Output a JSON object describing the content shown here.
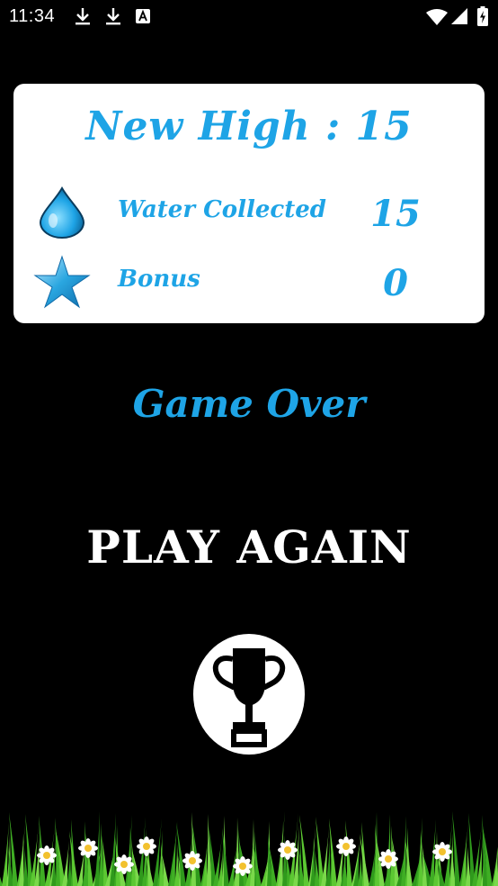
{
  "status_bar": {
    "time": "11:34",
    "icons": [
      "download-icon",
      "download-icon",
      "text-notification-icon",
      "wifi-icon",
      "signal-icon",
      "battery-charging-icon"
    ]
  },
  "score_card": {
    "title": "New High : 15",
    "rows": [
      {
        "icon": "water-drop-icon",
        "label": "Water Collected",
        "value": "15"
      },
      {
        "icon": "star-icon",
        "label": "Bonus",
        "value": "0"
      }
    ]
  },
  "game_over_text": "Game Over",
  "play_again_label": "PLAY AGAIN",
  "leaderboard_icon": "trophy-icon",
  "colors": {
    "accent_blue": "#1ea4e6",
    "background": "#000000",
    "card": "#ffffff",
    "grass": "#5cc832"
  }
}
